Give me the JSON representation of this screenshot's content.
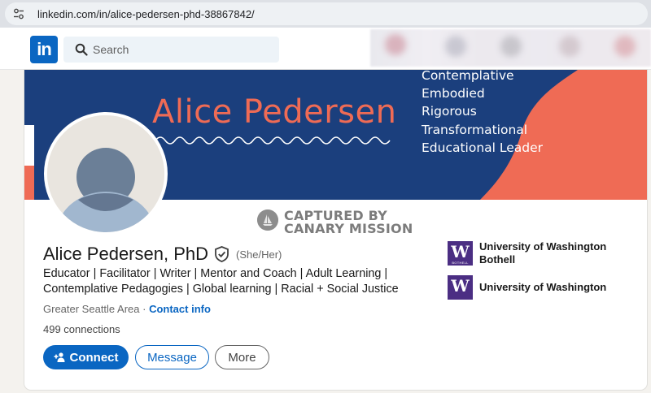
{
  "browser": {
    "url": "linkedin.com/in/alice-pedersen-phd-38867842/",
    "tune_icon": "tune-icon"
  },
  "nav": {
    "logo_text": "in",
    "search_placeholder": "Search",
    "colors": {
      "brand": "#0a66c2",
      "search_bg": "#edf3f8"
    }
  },
  "banner": {
    "name": "Alice Pedersen",
    "words": [
      "Contemplative",
      "Embodied",
      "Rigorous",
      "Transformational",
      "Educational Leader"
    ],
    "colors": {
      "navy": "#1b3f7d",
      "coral": "#ef6b55"
    }
  },
  "watermark": {
    "line1": "CAPTURED BY",
    "line2": "CANARY MISSION"
  },
  "profile": {
    "name": "Alice Pedersen, PhD",
    "pronouns": "(She/Her)",
    "headline": "Educator | Facilitator | Writer | Mentor and Coach | Adult Learning | Contemplative Pedagogies | Global learning | Racial + Social Justice",
    "location": "Greater Seattle Area",
    "location_sep": " · ",
    "contact_info": "Contact info",
    "connections": "499 connections"
  },
  "actions": {
    "connect": "Connect",
    "message": "Message",
    "more": "More"
  },
  "education": [
    {
      "logo": "W",
      "logo_sub": "BOTHELL",
      "name": "University of Washington Bothell"
    },
    {
      "logo": "W",
      "logo_sub": "",
      "name": "University of Washington"
    }
  ]
}
